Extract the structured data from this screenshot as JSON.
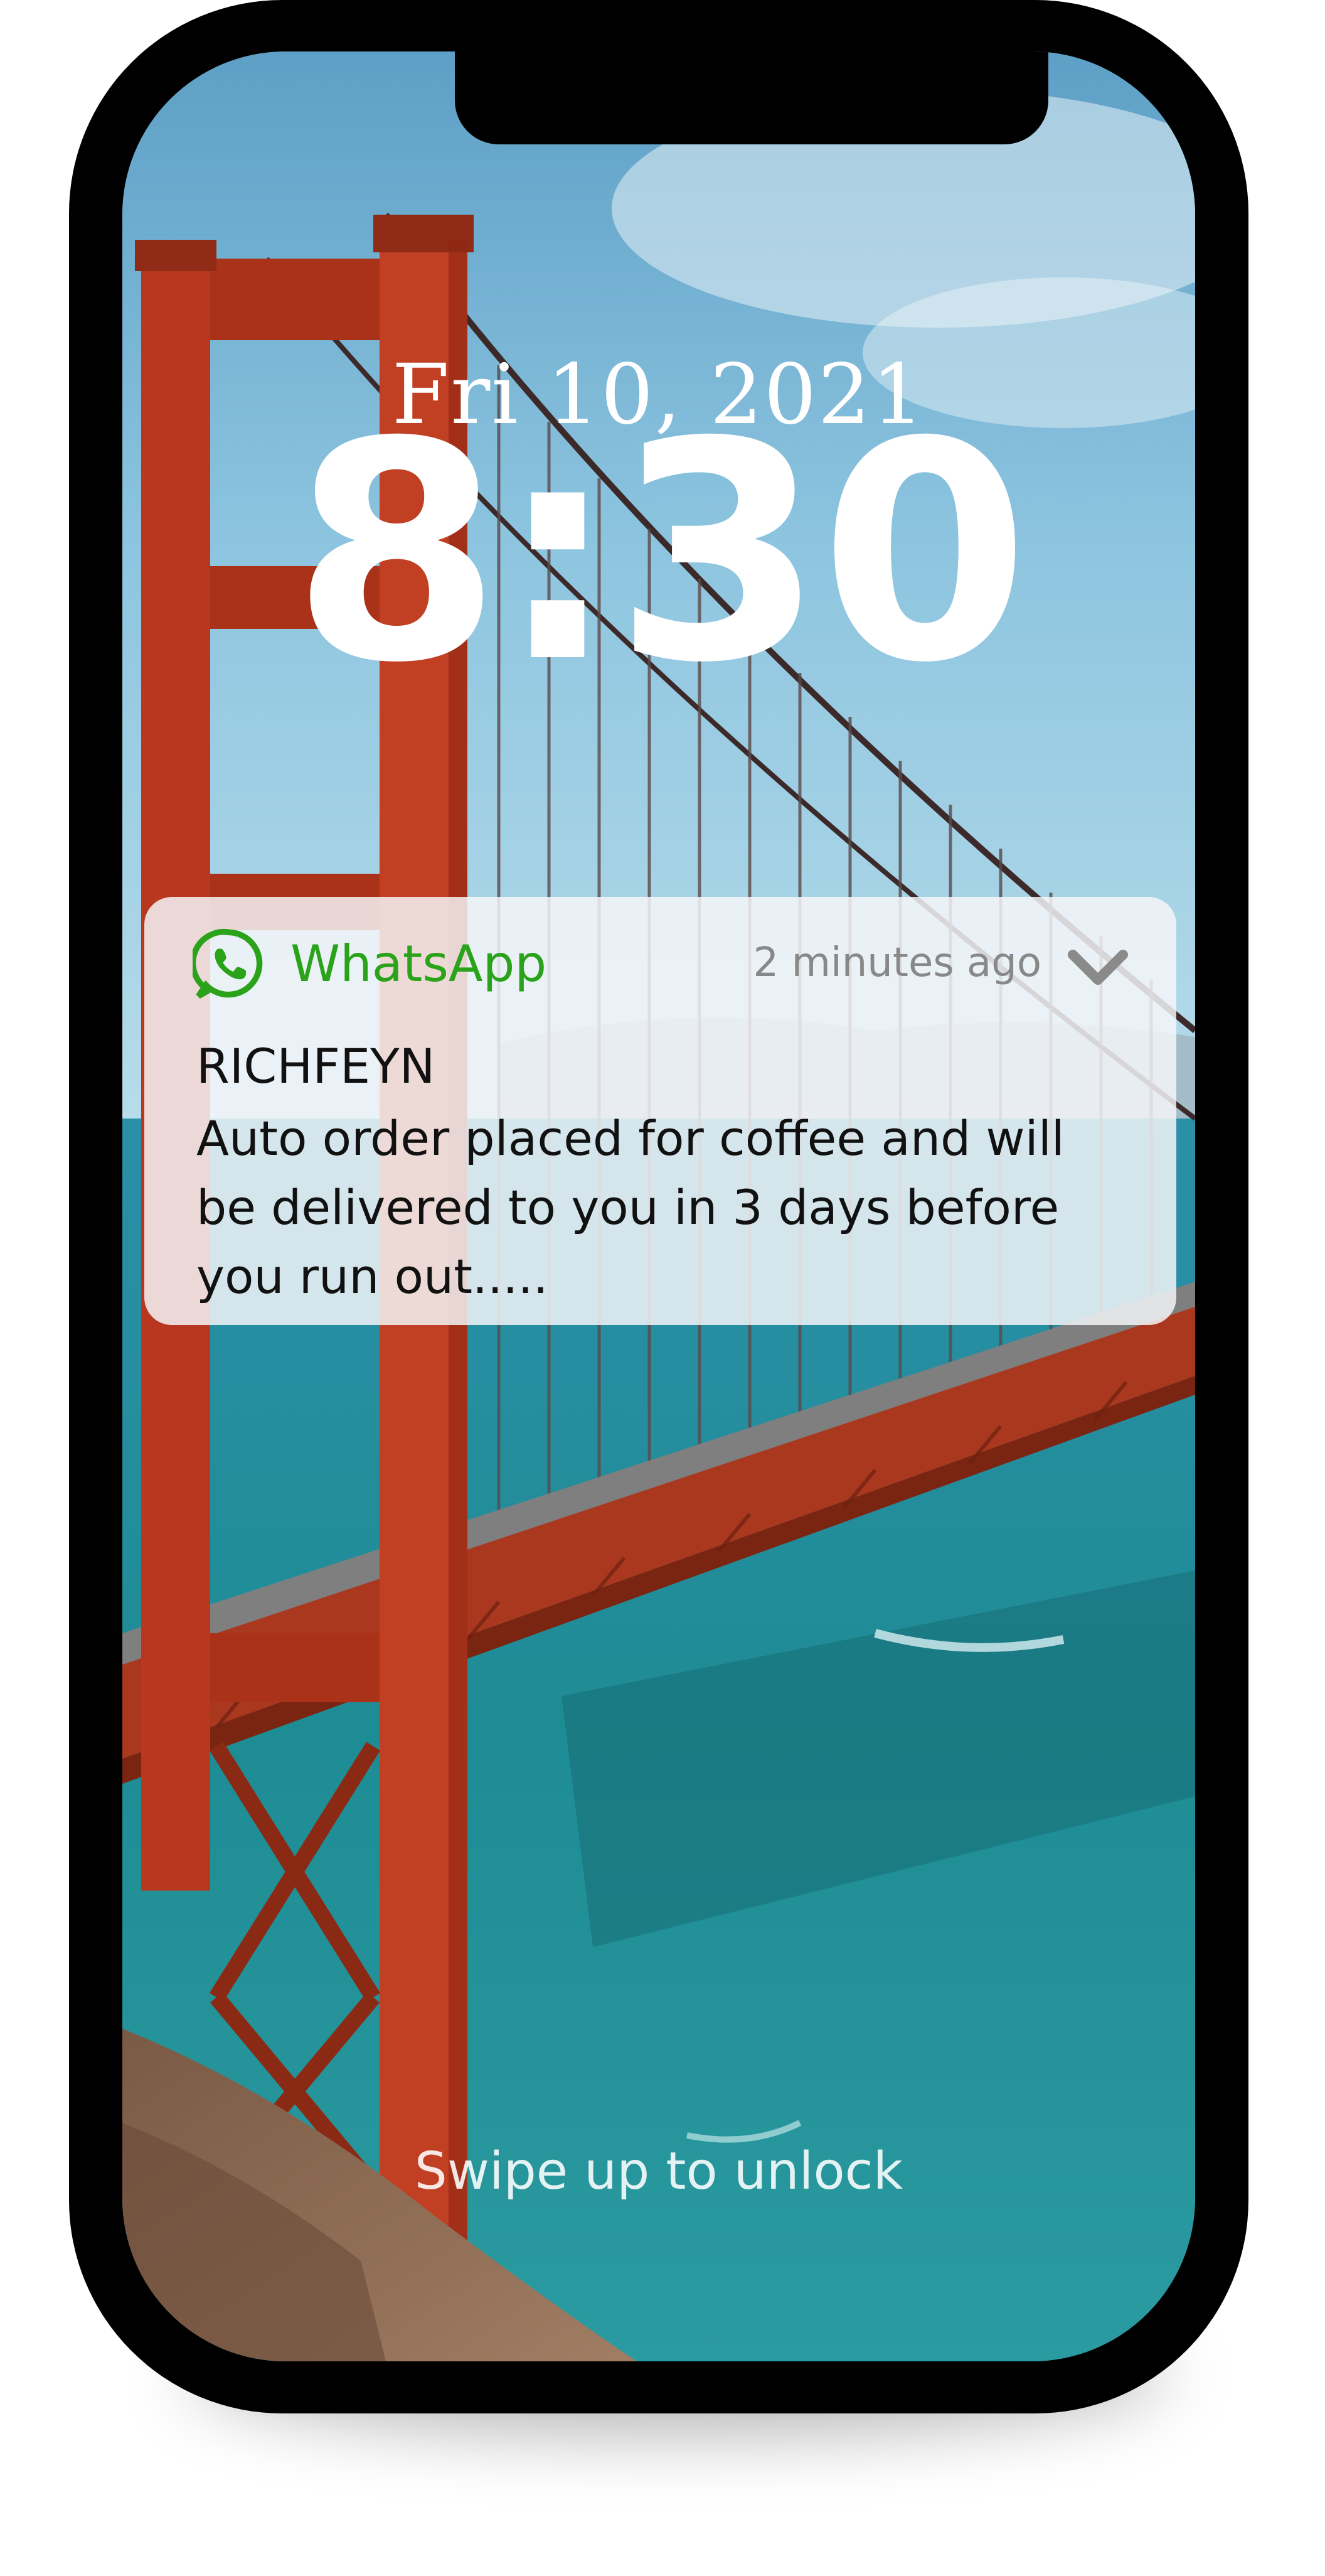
{
  "lock_screen": {
    "date": "Fri 10, 2021",
    "time": "8:30",
    "unlock_hint": "Swipe up to unlock"
  },
  "notification": {
    "app_name": "WhatsApp",
    "timestamp": "2 minutes ago",
    "sender": "RICHFEYN",
    "message": "Auto order placed for coffee and will be delivered to you in 3 days before you run out.....",
    "app_icon": "whatsapp-icon",
    "expand_icon": "chevron-down-icon"
  },
  "colors": {
    "whatsapp_green": "#2aa21a",
    "bridge_red": "#b8381f",
    "sea_teal": "#1f8e96",
    "sky_blue": "#6cb6d8"
  },
  "wallpaper": "golden-gate-bridge"
}
